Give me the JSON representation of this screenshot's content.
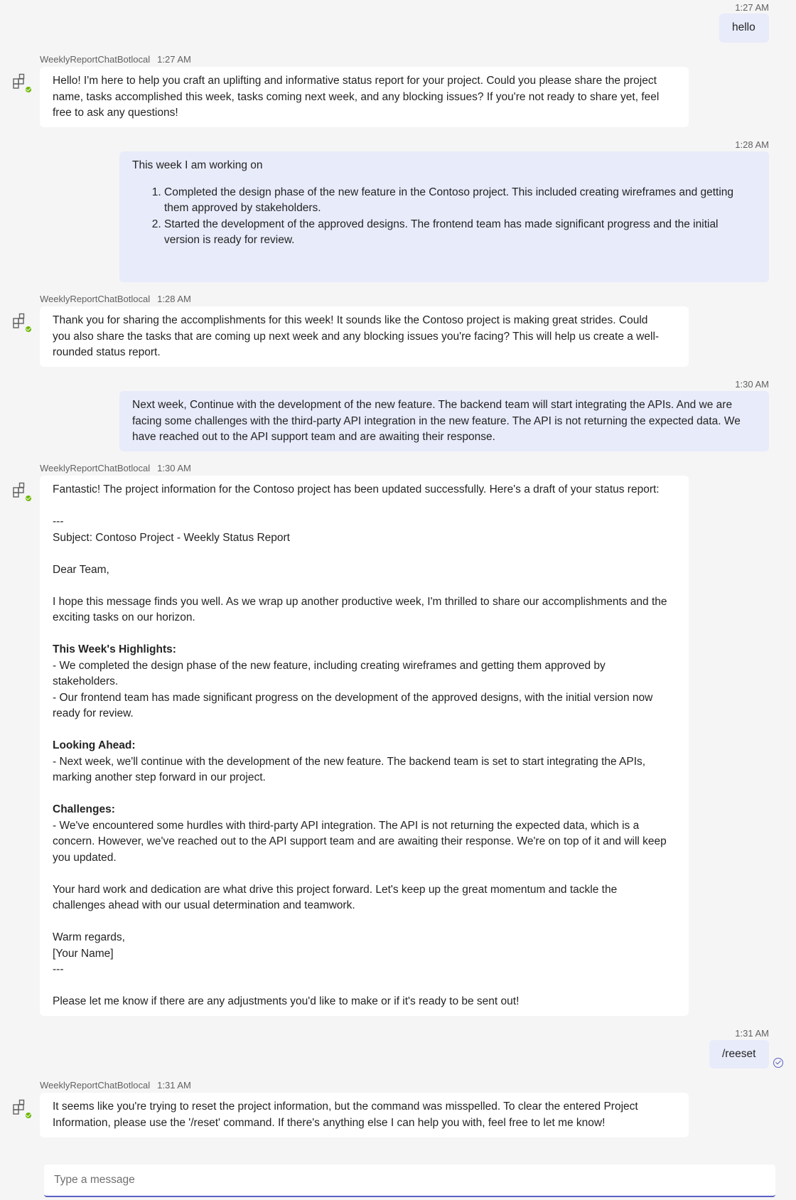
{
  "bot_name": "WeeklyReportChatBotlocal",
  "messages": [
    {
      "sender": "user",
      "time": "1:27 AM",
      "text": "hello"
    },
    {
      "sender": "bot",
      "time": "1:27 AM",
      "lines": [
        "Hello! I'm here to help you craft an uplifting and informative status report for your project. Could you please share the project",
        "name, tasks accomplished this week, tasks coming next week, and any blocking issues? If you're not ready to share yet, feel",
        "free to ask any questions!"
      ]
    },
    {
      "sender": "user",
      "time": "1:28 AM",
      "intro": "This week I am working on",
      "items": [
        [
          "Completed the design phase of the new feature in the Contoso project. This included creating wireframes and getting",
          "them approved by stakeholders."
        ],
        [
          "Started the development of the approved designs. The frontend team has made significant progress and the initial",
          "version is ready for review."
        ]
      ]
    },
    {
      "sender": "bot",
      "time": "1:28 AM",
      "lines": [
        "Thank you for sharing the accomplishments for this week! It sounds like the Contoso project is making great strides. Could",
        "you also share the tasks that are coming up next week and any blocking issues you're facing? This will help us create a well-",
        "rounded status report."
      ]
    },
    {
      "sender": "user",
      "time": "1:30 AM",
      "lines": [
        "Next week, Continue with the development of the new feature. The backend team will start integrating the APIs. And we are",
        "facing some challenges with the third-party API integration in the new feature. The API is not returning the expected data. We",
        "have reached out to the API support team and are awaiting their response."
      ]
    },
    {
      "sender": "bot",
      "time": "1:30 AM",
      "report": {
        "intro": "Fantastic! The project information for the Contoso project has been updated successfully. Here's a draft of your status report:",
        "sep": "---",
        "subject": "Subject: Contoso Project - Weekly Status Report",
        "greeting": "Dear Team,",
        "opening": [
          "I hope this message finds you well. As we wrap up another productive week, I'm thrilled to share our accomplishments and the",
          "exciting tasks on our horizon."
        ],
        "highlights_heading": "This Week's Highlights:",
        "highlights": [
          "- We completed the design phase of the new feature, including creating wireframes and getting them approved by",
          "stakeholders.",
          "- Our frontend team has made significant progress on the development of the approved designs, with the initial version now",
          "ready for review."
        ],
        "ahead_heading": "Looking Ahead:",
        "ahead": [
          "- Next week, we'll continue with the development of the new feature. The backend team is set to start integrating the APIs,",
          "marking another step forward in our project."
        ],
        "challenges_heading": "Challenges:",
        "challenges": [
          "- We've encountered some hurdles with third-party API integration. The API is not returning the expected data, which is a",
          "concern. However, we've reached out to the API support team and are awaiting their response. We're on top of it and will keep",
          "you updated."
        ],
        "closing": [
          "Your hard work and dedication are what drive this project forward. Let's keep up the great momentum and tackle the",
          "challenges ahead with our usual determination and teamwork."
        ],
        "signoff": "Warm regards,",
        "signature": "[Your Name]",
        "sep_end": "---",
        "footer": "Please let me know if there are any adjustments you'd like to make or if it's ready to be sent out!"
      }
    },
    {
      "sender": "user",
      "time": "1:31 AM",
      "text": "/reeset"
    },
    {
      "sender": "bot",
      "time": "1:31 AM",
      "lines": [
        "It seems like you're trying to reset the project information, but the command was misspelled. To clear the entered Project",
        "Information, please use the '/reset' command. If there's anything else I can help you with, feel free to let me know!"
      ]
    }
  ],
  "composer": {
    "placeholder": "Type a message"
  },
  "colors": {
    "background": "#f5f5f5",
    "user_bubble": "#e8ebfa",
    "bot_bubble": "#ffffff",
    "accent": "#5b5fc7",
    "presence": "#6bb700"
  },
  "icons": [
    "bot-app-icon",
    "presence-available-icon",
    "read-receipt-icon"
  ]
}
